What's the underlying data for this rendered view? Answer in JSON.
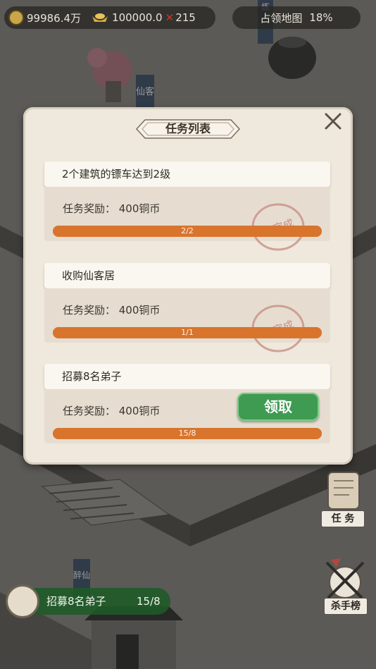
{
  "hud": {
    "coins": "99986.4万",
    "ingots": "100000.0",
    "tokens": "215",
    "occupy_map": "占领地图",
    "occupy_pct": "18%"
  },
  "dialog": {
    "title": "任务列表",
    "tasks": [
      {
        "name": "2个建筑的镖车达到2级",
        "reward": "任务奖励：  400铜币",
        "progress": "2/2",
        "progress_fraction": 1.0,
        "status": "已完成"
      },
      {
        "name": "收购仙客居",
        "reward": "任务奖励：  400铜币",
        "progress": "1/1",
        "progress_fraction": 1.0,
        "status": "已完成"
      },
      {
        "name": "招募8名弟子",
        "reward": "任务奖励：  400铜币",
        "progress": "15/8",
        "progress_fraction": 1.0,
        "claim_label": "领取"
      }
    ]
  },
  "side": {
    "tasks_label": "任 务",
    "killer_label": "杀手榜"
  },
  "scene_signs": {
    "top": "炼",
    "xianke": "仙客",
    "zui": "醉仙"
  },
  "tracker": {
    "text": "招募8名弟子",
    "count": "15/8"
  },
  "colors": {
    "progress": "#d9742c",
    "claim": "#3f9a52",
    "stamp": "#c98f86"
  }
}
